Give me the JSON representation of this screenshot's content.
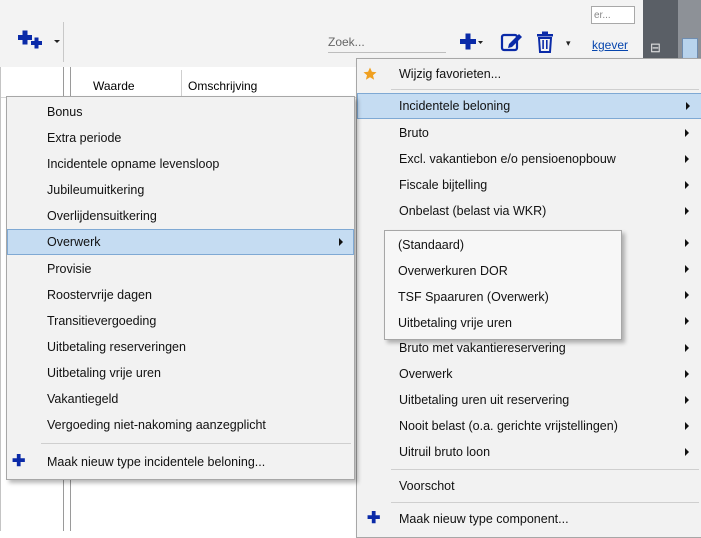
{
  "toolbar": {
    "search_placeholder": "Zoek...",
    "top_field_value": "er...",
    "link_text": "kgever",
    "trash_dropdown": "▾",
    "dark_strip_glyph": "⊟"
  },
  "grid": {
    "columns": [
      "Waarde",
      "Omschrijving"
    ]
  },
  "left_menu": {
    "items": [
      {
        "label": "Bonus"
      },
      {
        "label": "Extra periode"
      },
      {
        "label": "Incidentele opname levensloop"
      },
      {
        "label": "Jubileumuitkering"
      },
      {
        "label": "Overlijdensuitkering"
      },
      {
        "label": "Overwerk"
      },
      {
        "label": "Provisie"
      },
      {
        "label": "Roostervrije dagen"
      },
      {
        "label": "Transitievergoeding"
      },
      {
        "label": "Uitbetaling reserveringen"
      },
      {
        "label": "Uitbetaling vrije uren"
      },
      {
        "label": "Vakantiegeld"
      },
      {
        "label": "Vergoeding niet-nakoming aanzegplicht"
      }
    ],
    "new_type_label": "Maak nieuw type incidentele beloning..."
  },
  "right_menu": {
    "favorites_label": "Wijzig favorieten...",
    "items": [
      {
        "label": "Incidentele beloning"
      },
      {
        "label": "Bruto"
      },
      {
        "label": "Excl. vakantiebon e/o pensioenopbouw"
      },
      {
        "label": "Fiscale bijtelling"
      },
      {
        "label": "Onbelast (belast via WKR)"
      },
      {
        "label": ""
      },
      {
        "label": ""
      },
      {
        "label": ""
      },
      {
        "label": ""
      },
      {
        "label": "Bruto met vakantiereservering"
      },
      {
        "label": "Overwerk"
      },
      {
        "label": "Uitbetaling uren uit reservering"
      },
      {
        "label": "Nooit belast (o.a. gerichte vrijstellingen)"
      },
      {
        "label": "Uitruil bruto loon"
      }
    ],
    "voorschot_label": "Voorschot",
    "new_type_label": "Maak nieuw type component..."
  },
  "sub_menu": {
    "items": [
      {
        "label": "(Standaard)"
      },
      {
        "label": "Overwerkuren DOR"
      },
      {
        "label": "TSF Spaaruren (Overwerk)"
      },
      {
        "label": "Uitbetaling vrije uren"
      }
    ]
  },
  "colors": {
    "highlight_bg": "#c5dcf2",
    "highlight_border": "#7fa9d4",
    "icon_blue": "#0a2aa8",
    "star": "#f0a020"
  }
}
